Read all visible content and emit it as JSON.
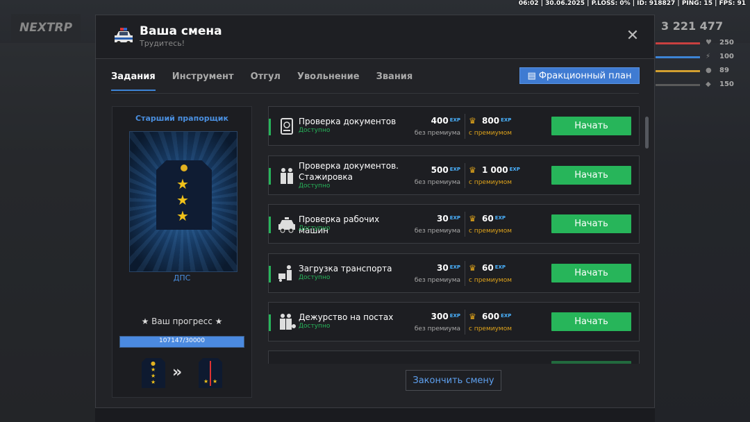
{
  "status_bar": "06:02 | 30.06.2025 | P.LOSS: 0% | ID: 918827 | PING: 15 | FPS: 91",
  "hud": {
    "logo": "NEXTRP",
    "money": "3 221 477",
    "health": "250",
    "energy": "100",
    "food": "89",
    "armor": "150",
    "hunger_colors": [
      "#c94040",
      "#3d84d6",
      "#d2a030",
      "#5a5a5a"
    ]
  },
  "modal": {
    "title": "Ваша смена",
    "subtitle": "Трудитесь!",
    "close_icon": "close-icon",
    "tabs": [
      "Задания",
      "Инструмент",
      "Отгул",
      "Увольнение",
      "Звания"
    ],
    "active_tab": 0,
    "plan_button": "Фракционный план",
    "finish_button": "Закончить смену"
  },
  "rank": {
    "title": "Старший прапорщик",
    "department": "ДПС",
    "progress_label": "★ Ваш прогресс ★",
    "progress_text": "107147/30000",
    "progress_fraction": 1.0
  },
  "tasks": [
    {
      "name": "Проверка документов",
      "status": "Доступно",
      "exp": "400",
      "exp_premium": "800",
      "icon": "passport-icon"
    },
    {
      "name": "Проверка документов. Стажировка",
      "status": "Доступно",
      "exp": "500",
      "exp_premium": "1 000",
      "icon": "officers-icon"
    },
    {
      "name": "Проверка рабочих машин",
      "status": "Доступно",
      "exp": "30",
      "exp_premium": "60",
      "icon": "police-car-icon"
    },
    {
      "name": "Загрузка транспорта",
      "status": "Доступно",
      "exp": "30",
      "exp_premium": "60",
      "icon": "loading-icon"
    },
    {
      "name": "Дежурство на постах",
      "status": "Доступно",
      "exp": "300",
      "exp_premium": "600",
      "icon": "guard-post-icon"
    }
  ],
  "labels": {
    "exp_unit": "EXP",
    "no_premium": "без премиума",
    "with_premium": "с премиумом",
    "start": "Начать"
  },
  "colors": {
    "accent": "#3d84d6",
    "success": "#27b55a",
    "gold": "#e0a41b",
    "exp": "#4ab2ff"
  }
}
